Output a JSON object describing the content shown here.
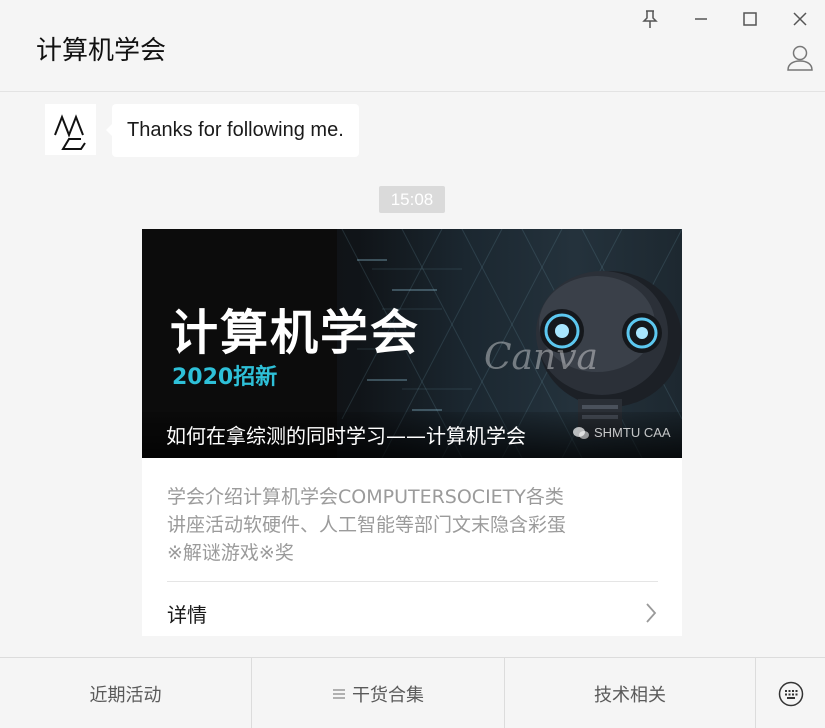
{
  "header": {
    "title": "计算机学会"
  },
  "window_controls": {
    "icons": [
      "pin-icon",
      "minimize-icon",
      "maximize-icon",
      "close-icon"
    ]
  },
  "chat": {
    "message": {
      "avatar_icon": "mg-logo-icon",
      "text": "Thanks for following me."
    },
    "timestamp": "15:08",
    "article": {
      "cover": {
        "title": "计算机学会",
        "subtitle": "2020招新",
        "watermark_canva": "Canva",
        "watermark_source": "SHMTU CAA"
      },
      "headline": "如何在拿综测的同时学习——计算机学会",
      "summary_lines": [
        "学会介绍计算机学会COMPUTERSOCIETY各类",
        "讲座活动软硬件、人工智能等部门文末隐含彩蛋",
        "※解谜游戏※奖"
      ],
      "details_label": "详情"
    }
  },
  "menu": {
    "items": [
      {
        "label": "近期活动"
      },
      {
        "label": "干货合集",
        "icon": "menu-lines-icon"
      },
      {
        "label": "技术相关"
      }
    ],
    "keyboard_icon": "keyboard-icon"
  },
  "colors": {
    "background": "#f5f5f5",
    "accent_cyan": "#2ec0d8",
    "timestamp_bg": "#dadada",
    "summary_text": "#9b9b9b"
  }
}
